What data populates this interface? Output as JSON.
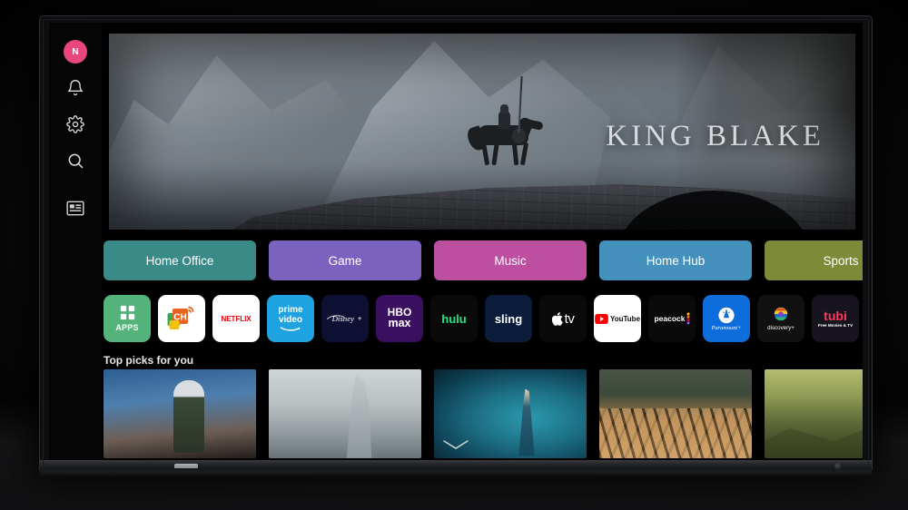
{
  "device": {
    "type": "smart-tv",
    "brand_mark": ""
  },
  "sidebar": {
    "avatar_initial": "N",
    "items": [
      {
        "name": "profile-avatar",
        "icon": "avatar-icon",
        "label": "N"
      },
      {
        "name": "notifications",
        "icon": "bell-icon",
        "label": "Notifications"
      },
      {
        "name": "settings",
        "icon": "gear-icon",
        "label": "Settings"
      },
      {
        "name": "search",
        "icon": "search-icon",
        "label": "Search"
      },
      {
        "name": "inputs",
        "icon": "input-source-icon",
        "label": "Inputs"
      }
    ]
  },
  "hero": {
    "title": "KING BLAKE",
    "artwork_alt": "Knight on horseback crossing a stone bridge before misty mountains"
  },
  "categories": [
    {
      "label": "Home Office",
      "color": "#3a8a88"
    },
    {
      "label": "Game",
      "color": "#7b62bf"
    },
    {
      "label": "Music",
      "color": "#bd4fa0"
    },
    {
      "label": "Home Hub",
      "color": "#4491bd"
    },
    {
      "label": "Sports",
      "color": "#7d8b38"
    }
  ],
  "apps": [
    {
      "name": "apps",
      "label": "APPS",
      "bg": "#54b37a",
      "fg": "#ffffff"
    },
    {
      "name": "channels",
      "label": "CH",
      "bg": "#ffffff",
      "fg": "#e8631f"
    },
    {
      "name": "netflix",
      "label": "NETFLIX",
      "bg": "#ffffff",
      "fg": "#e50914"
    },
    {
      "name": "prime-video",
      "label": "prime video",
      "bg": "#1fa2e0",
      "fg": "#ffffff"
    },
    {
      "name": "disney-plus",
      "label": "Disney+",
      "bg": "#0d1033",
      "fg": "#ffffff"
    },
    {
      "name": "hbo-max",
      "label": "HBO max",
      "bg": "#3b1060",
      "fg": "#ffffff"
    },
    {
      "name": "hulu",
      "label": "hulu",
      "bg": "#0a0a0a",
      "fg": "#1ce783"
    },
    {
      "name": "sling",
      "label": "sling",
      "bg": "#0b1b3a",
      "fg": "#ffffff"
    },
    {
      "name": "apple-tv",
      "label": "tv",
      "bg": "#0a0a0a",
      "fg": "#ffffff"
    },
    {
      "name": "youtube",
      "label": "YouTube",
      "bg": "#ffffff",
      "fg": "#0a0a0a"
    },
    {
      "name": "peacock",
      "label": "peacock",
      "bg": "#0a0a0a",
      "fg": "#ffffff"
    },
    {
      "name": "paramount-plus",
      "label": "Paramount+",
      "bg": "#0f6cdb",
      "fg": "#ffffff"
    },
    {
      "name": "discovery-plus",
      "label": "discovery+",
      "bg": "#111111",
      "fg": "#ffffff"
    },
    {
      "name": "tubi",
      "label": "tubi",
      "bg": "#171420",
      "fg": "#ff3b5c",
      "sublabel": "Free Movies & TV"
    },
    {
      "name": "sports-alerts",
      "label": "",
      "bg": "#7a6ddb",
      "fg": "#ffffff"
    }
  ],
  "rows": [
    {
      "title": "Top picks for you",
      "items": [
        {
          "name": "pick-astronaut",
          "alt": "Person in astronaut helmet on a hillside"
        },
        {
          "name": "pick-hooded-figure",
          "alt": "Hooded figure holding a sword in the clouds"
        },
        {
          "name": "pick-woman-blue-dress",
          "alt": "Woman in a long blue gown by teal water"
        },
        {
          "name": "pick-maze",
          "alt": "Wooden labyrinth maze in a forest"
        },
        {
          "name": "pick-green-hills",
          "alt": "Layered green mountain ridges"
        }
      ]
    }
  ],
  "footer": {
    "scroll_hint_icon": "chevron-down-icon"
  }
}
